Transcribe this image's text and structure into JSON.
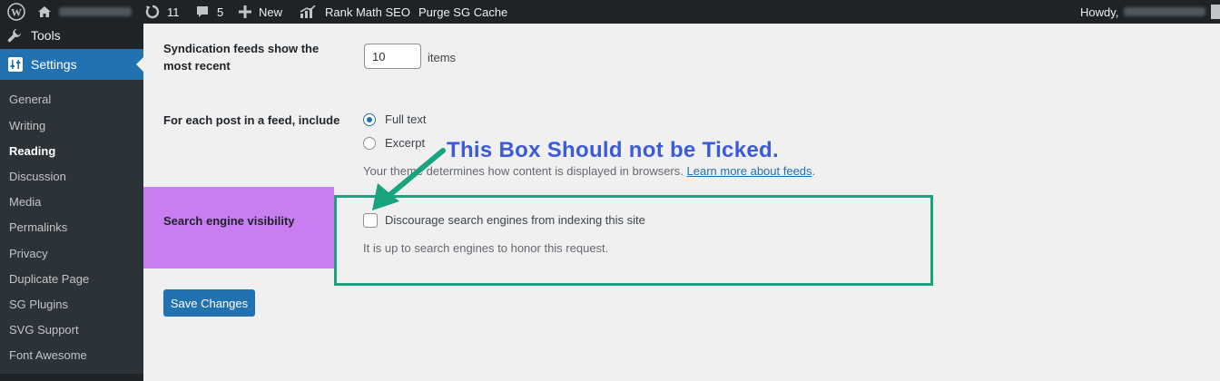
{
  "admin_bar": {
    "updates_count": "11",
    "comments_count": "5",
    "new_label": "New",
    "rank_math_label": "Rank Math SEO",
    "purge_cache_label": "Purge SG Cache",
    "howdy_label": "Howdy,"
  },
  "sidebar": {
    "tools_label": "Tools",
    "settings_label": "Settings",
    "submenu": [
      "General",
      "Writing",
      "Reading",
      "Discussion",
      "Media",
      "Permalinks",
      "Privacy",
      "Duplicate Page",
      "SG Plugins",
      "SVG Support",
      "Font Awesome"
    ],
    "current": "Reading"
  },
  "form": {
    "syndication_label_line1": "Syndication feeds show the",
    "syndication_label_line2": "most recent",
    "syndication_value": "10",
    "syndication_suffix": "items",
    "feed_include_label": "For each post in a feed, include",
    "full_text_label": "Full text",
    "excerpt_label": "Excerpt",
    "full_text_selected": true,
    "feed_desc_prefix": "Your theme determines how content is displayed in browsers.",
    "feed_desc_link": "Learn more about feeds",
    "feed_desc_suffix": ".",
    "visibility_label": "Search engine visibility",
    "discourage_label": "Discourage search engines from indexing this site",
    "discourage_checked": false,
    "visibility_desc": "It is up to search engines to honor this request.",
    "save_label": "Save Changes"
  },
  "annotation": {
    "text": "This Box Should not be Ticked.",
    "arrow_color": "#1aa37f",
    "text_color": "#3b5bdb",
    "box_color": "#1aa37f",
    "label_bg_color": "#c87ef0"
  }
}
